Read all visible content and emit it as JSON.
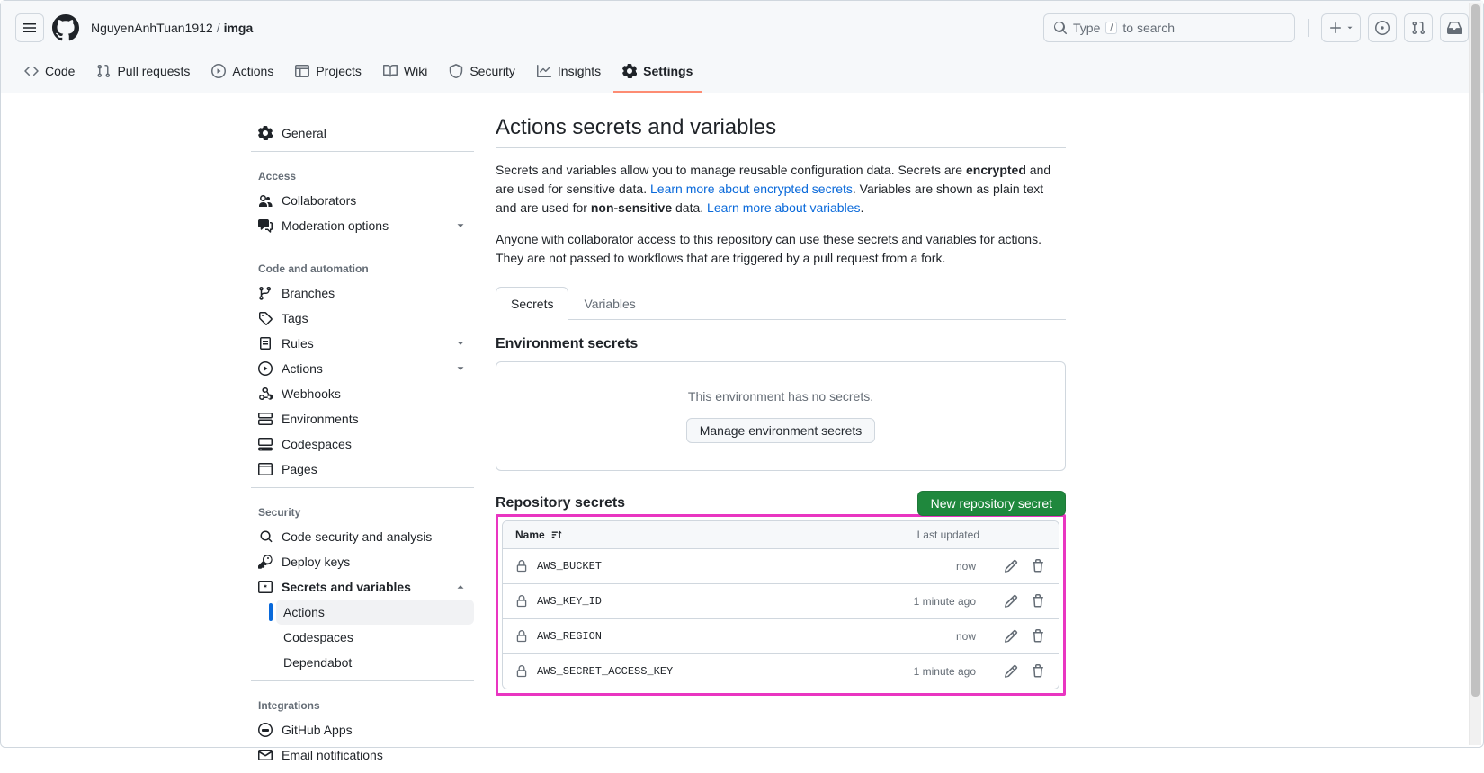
{
  "header": {
    "owner": "NguyenAnhTuan1912",
    "repo": "imga",
    "search_placeholder": "Type",
    "search_hint_after": "to search"
  },
  "repo_nav": {
    "code": "Code",
    "pulls": "Pull requests",
    "actions": "Actions",
    "projects": "Projects",
    "wiki": "Wiki",
    "security": "Security",
    "insights": "Insights",
    "settings": "Settings"
  },
  "sidebar": {
    "general": "General",
    "access_heading": "Access",
    "collaborators": "Collaborators",
    "moderation": "Moderation options",
    "code_heading": "Code and automation",
    "branches": "Branches",
    "tags": "Tags",
    "rules": "Rules",
    "actions": "Actions",
    "webhooks": "Webhooks",
    "environments": "Environments",
    "codespaces": "Codespaces",
    "pages": "Pages",
    "security_heading": "Security",
    "code_sec": "Code security and analysis",
    "deploy_keys": "Deploy keys",
    "secrets": "Secrets and variables",
    "secrets_actions": "Actions",
    "secrets_codespaces": "Codespaces",
    "secrets_dependabot": "Dependabot",
    "integrations_heading": "Integrations",
    "github_apps": "GitHub Apps",
    "email_notif": "Email notifications"
  },
  "main": {
    "title": "Actions secrets and variables",
    "intro1_a": "Secrets and variables allow you to manage reusable configuration data. Secrets are ",
    "intro1_b": "encrypted",
    "intro1_c": " and are used for sensitive data. ",
    "intro1_link1": "Learn more about encrypted secrets",
    "intro1_d": ". Variables are shown as plain text and are used for ",
    "intro1_e": "non-sensitive",
    "intro1_f": " data. ",
    "intro1_link2": "Learn more about variables",
    "intro1_g": ".",
    "intro2": "Anyone with collaborator access to this repository can use these secrets and variables for actions. They are not passed to workflows that are triggered by a pull request from a fork.",
    "tab_secrets": "Secrets",
    "tab_variables": "Variables",
    "env_title": "Environment secrets",
    "env_empty": "This environment has no secrets.",
    "env_btn": "Manage environment secrets",
    "repo_title": "Repository secrets",
    "new_btn": "New repository secret",
    "col_name": "Name",
    "col_updated": "Last updated",
    "secrets": [
      {
        "name": "AWS_BUCKET",
        "updated": "now"
      },
      {
        "name": "AWS_KEY_ID",
        "updated": "1 minute ago"
      },
      {
        "name": "AWS_REGION",
        "updated": "now"
      },
      {
        "name": "AWS_SECRET_ACCESS_KEY",
        "updated": "1 minute ago"
      }
    ]
  }
}
